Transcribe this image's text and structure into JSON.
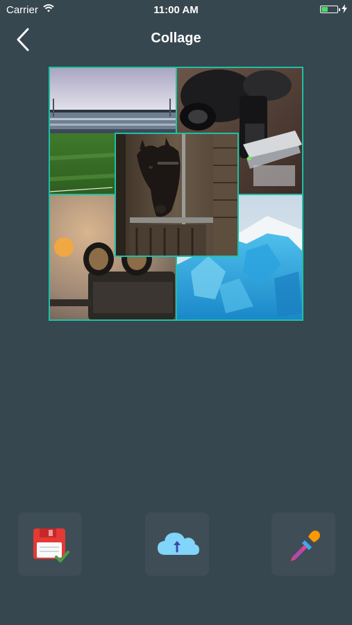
{
  "status_bar": {
    "carrier": "Carrier",
    "time": "11:00 AM"
  },
  "nav": {
    "title": "Collage"
  },
  "collage": {
    "photos": [
      "stadium",
      "microscope",
      "binoculars",
      "blue-ice",
      "horse"
    ],
    "border_color": "#1fc0a5"
  },
  "toolbar": {
    "buttons": [
      "save",
      "upload",
      "color-picker"
    ]
  },
  "colors": {
    "background": "#37474f",
    "button": "#3f4e56",
    "accent": "#1fc0a5"
  }
}
